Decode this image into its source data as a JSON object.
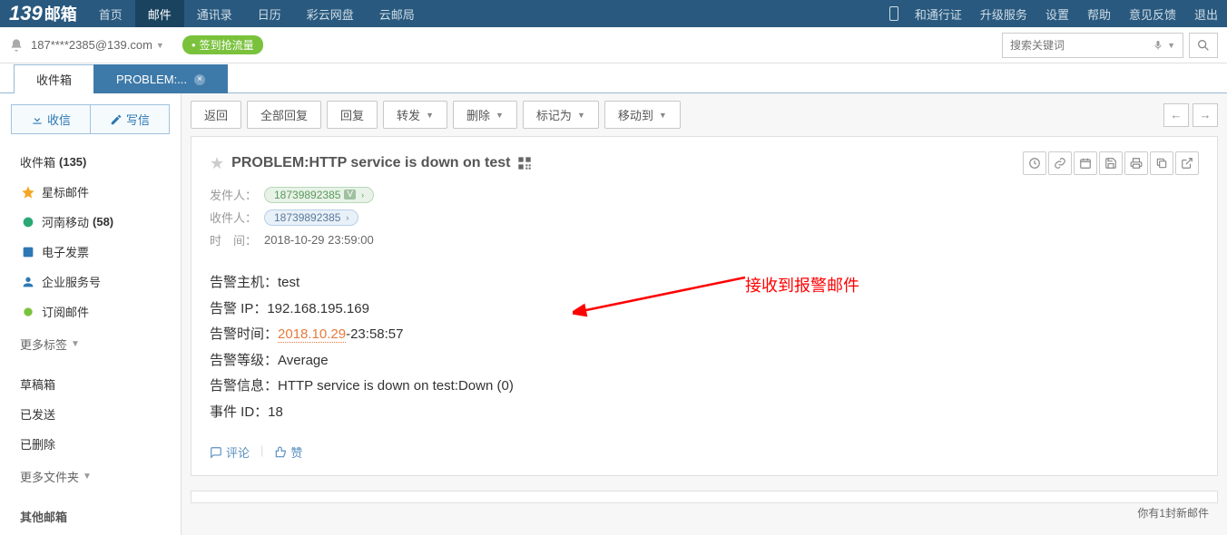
{
  "topbar": {
    "logo_num": "139",
    "logo_txt": "邮箱",
    "nav": [
      "首页",
      "邮件",
      "通讯录",
      "日历",
      "彩云网盘",
      "云邮局"
    ],
    "active_index": 1,
    "right": [
      "和通行证",
      "升级服务",
      "设置",
      "帮助",
      "意见反馈",
      "退出"
    ]
  },
  "subbar": {
    "email": "187****2385@139.com",
    "signin": "签到抢流量",
    "search_placeholder": "搜索关键词"
  },
  "tabs": [
    {
      "label": "收件箱",
      "active": false
    },
    {
      "label": "PROBLEM:...",
      "active": true,
      "close": true
    }
  ],
  "sidebar": {
    "receive": "收信",
    "compose": "写信",
    "folders": [
      {
        "icon": "inbox",
        "label": "收件箱",
        "count": "(135)",
        "color": ""
      },
      {
        "icon": "star",
        "label": "星标邮件",
        "count": "",
        "color": "#f5a623"
      },
      {
        "icon": "mobile",
        "label": "河南移动",
        "count": "(58)",
        "color": "#2aa876"
      },
      {
        "icon": "invoice",
        "label": "电子发票",
        "count": "",
        "color": "#2d78b4"
      },
      {
        "icon": "corp",
        "label": "企业服务号",
        "count": "",
        "color": "#2d78b4"
      },
      {
        "icon": "sub",
        "label": "订阅邮件",
        "count": "",
        "color": "#7ac23c"
      }
    ],
    "more_tags": "更多标签",
    "plain": [
      "草稿箱",
      "已发送",
      "已删除"
    ],
    "more_folders": "更多文件夹",
    "other": "其他邮箱"
  },
  "toolbar": {
    "buttons": [
      {
        "label": "返回"
      },
      {
        "label": "全部回复"
      },
      {
        "label": "回复"
      },
      {
        "label": "转发",
        "chev": true
      },
      {
        "label": "删除",
        "chev": true
      },
      {
        "label": "标记为",
        "chev": true
      },
      {
        "label": "移动到",
        "chev": true
      }
    ]
  },
  "mail": {
    "subject": "PROBLEM:HTTP service is down on test",
    "sender_label": "发件人：",
    "sender": "18739892385",
    "recipient_label": "收件人：",
    "recipient": "18739892385",
    "time_label": "时　间：",
    "time": "2018-10-29 23:59:00",
    "body": {
      "host_label": "告警主机：",
      "host": "test",
      "ip_label": "告警 IP：",
      "ip": "192.168.195.169",
      "alarm_time_label": "告警时间：",
      "alarm_time_date": "2018.10.29",
      "alarm_time_rest": "-23:58:57",
      "level_label": "告警等级：",
      "level": "Average",
      "info_label": "告警信息：",
      "info": "HTTP service is down on test:Down (0)",
      "event_label": "事件 ID：",
      "event": "18"
    },
    "comment": "评论",
    "like": "赞"
  },
  "annotation": "接收到报警邮件",
  "status": "你有1封新邮件"
}
